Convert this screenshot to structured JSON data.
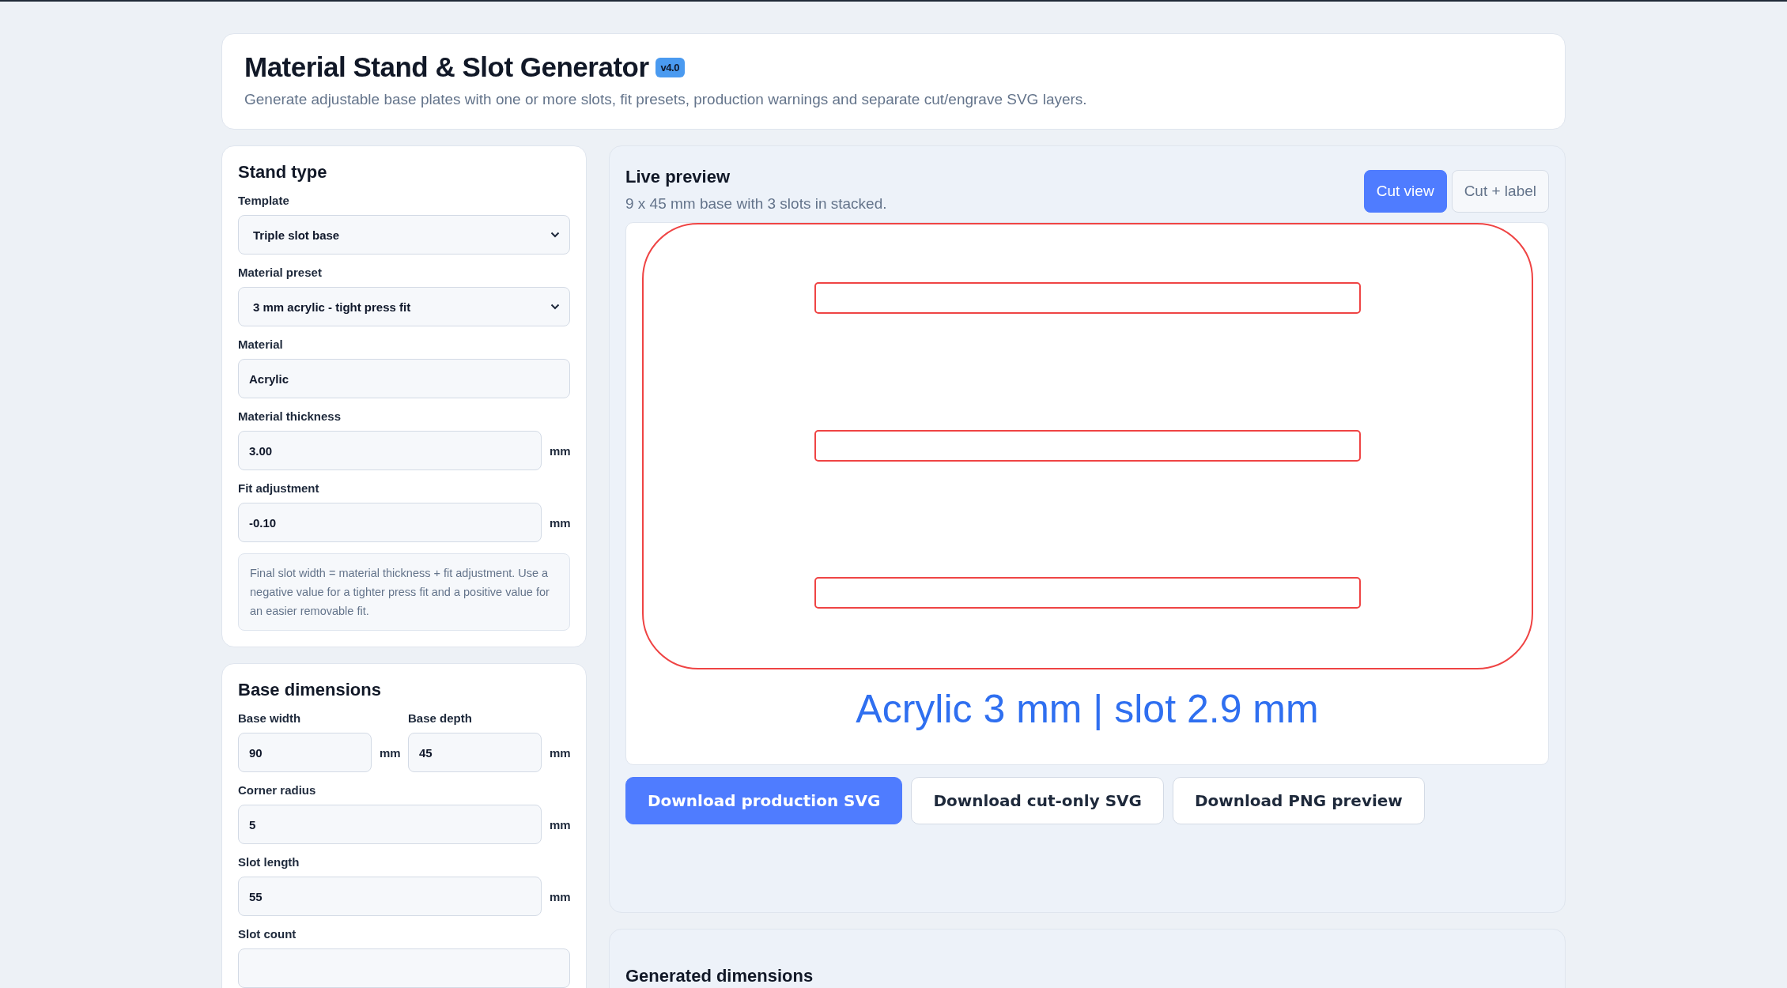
{
  "header": {
    "title": "Material Stand & Slot Generator",
    "version": "v4.0",
    "subtitle": "Generate adjustable base plates with one or more slots, fit presets, production warnings and separate cut/engrave SVG layers."
  },
  "sections": [
    {
      "title": "Stand type",
      "fields": [
        {
          "kind": "select",
          "label": "Template",
          "value": "Triple slot base"
        },
        {
          "kind": "select",
          "label": "Material preset",
          "value": "3 mm acrylic - tight press fit"
        },
        {
          "kind": "input",
          "label": "Material",
          "value": "Acrylic"
        },
        {
          "kind": "input",
          "label": "Material thickness",
          "value": "3.00",
          "unit": "mm"
        },
        {
          "kind": "input",
          "label": "Fit adjustment",
          "value": "-0.10",
          "unit": "mm"
        },
        {
          "kind": "note",
          "text": "Final slot width = material thickness + fit adjustment. Use a negative value for a tighter press fit and a positive value for an easier removable fit."
        }
      ]
    },
    {
      "title": "Base dimensions",
      "fields": [
        {
          "kind": "pair",
          "items": [
            {
              "label": "Base width",
              "value": "90",
              "unit": "mm"
            },
            {
              "label": "Base depth",
              "value": "45",
              "unit": "mm"
            }
          ]
        },
        {
          "kind": "input",
          "label": "Corner radius",
          "value": "5",
          "unit": "mm"
        },
        {
          "kind": "input",
          "label": "Slot length",
          "value": "55",
          "unit": "mm"
        },
        {
          "kind": "input",
          "label": "Slot count"
        }
      ]
    }
  ],
  "preview": {
    "title": "Live preview",
    "summary": "9 x 45 mm base with 3 slots in stacked.",
    "views": [
      {
        "label": "Cut view",
        "selected": true
      },
      {
        "label": "Cut + label",
        "selected": false
      }
    ],
    "engrave_label": "Acrylic 3 mm | slot 2.9 mm",
    "buttons": [
      {
        "label": "Download production SVG",
        "kind": "primary"
      },
      {
        "label": "Download cut-only SVG",
        "kind": "secondary"
      },
      {
        "label": "Download PNG preview",
        "kind": "secondary"
      }
    ]
  },
  "dimensions": {
    "title": "Generated dimensions"
  }
}
